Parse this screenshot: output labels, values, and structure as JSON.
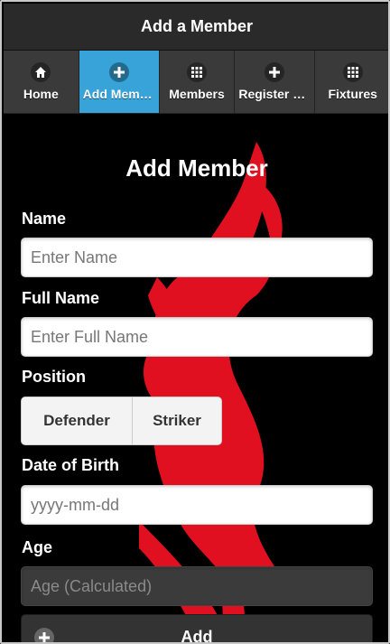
{
  "header": {
    "title": "Add a Member"
  },
  "nav": [
    {
      "label": "Home",
      "icon": "home-icon"
    },
    {
      "label": "Add Member",
      "icon": "plus-icon"
    },
    {
      "label": "Members",
      "icon": "grid-icon"
    },
    {
      "label": "Register Player",
      "icon": "plus-icon"
    },
    {
      "label": "Fixtures",
      "icon": "grid-icon"
    }
  ],
  "form": {
    "title": "Add Member",
    "name_label": "Name",
    "name_placeholder": "Enter Name",
    "fullname_label": "Full Name",
    "fullname_placeholder": "Enter Full Name",
    "position_label": "Position",
    "positions": [
      "Defender",
      "Striker"
    ],
    "dob_label": "Date of Birth",
    "dob_placeholder": "yyyy-mm-dd",
    "age_label": "Age",
    "age_placeholder": "Age (Calculated)",
    "add_label": "Add"
  },
  "colors": {
    "active_tab": "#38a3d9",
    "background": "#000000",
    "accent_red": "#e01020"
  }
}
